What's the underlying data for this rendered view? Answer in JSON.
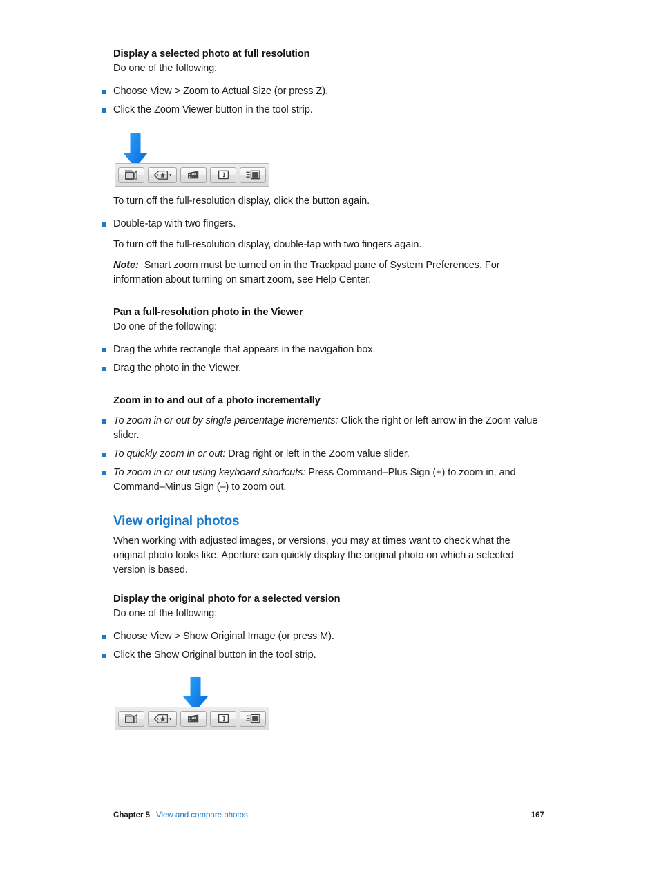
{
  "page": {
    "number": "167"
  },
  "sections": {
    "full_resolution": {
      "subhead": "Display a selected photo at full resolution",
      "intro": "Do one of the following:",
      "bullets": [
        "Choose View > Zoom to Actual Size (or press Z).",
        "Click the Zoom Viewer button in the tool strip."
      ],
      "after_figure": "To turn off the full-resolution display, click the button again.",
      "bullet_double_tap": "Double-tap with two fingers.",
      "after_double_tap": "To turn off the full-resolution display, double-tap with two fingers again.",
      "note_label": "Note:",
      "note_text": "Smart zoom must be turned on in the Trackpad pane of System Preferences. For information about turning on smart zoom, see Help Center."
    },
    "pan": {
      "subhead": "Pan a full-resolution photo in the Viewer",
      "intro": "Do one of the following:",
      "bullets": [
        "Drag the white rectangle that appears in the navigation box.",
        "Drag the photo in the Viewer."
      ]
    },
    "zoom_increments": {
      "subhead": "Zoom in to and out of a photo incrementally",
      "bullets": [
        {
          "lead_in": "To zoom in or out by single percentage increments:",
          "rest": " Click the right or left arrow in the Zoom value slider."
        },
        {
          "lead_in": "To quickly zoom in or out:",
          "rest": " Drag right or left in the Zoom value slider."
        },
        {
          "lead_in": "To zoom in or out using keyboard shortcuts:",
          "rest": " Press Command–Plus Sign (+) to zoom in, and Command–Minus Sign (–) to zoom out."
        }
      ]
    },
    "view_original": {
      "heading": "View original photos",
      "body": "When working with adjusted images, or versions, you may at times want to check what the original photo looks like. Aperture can quickly display the original photo on which a selected version is based.",
      "subhead": "Display the original photo for a selected version",
      "intro": "Do one of the following:",
      "bullets": [
        "Choose View > Show Original Image (or press M).",
        "Click the Show Original button in the tool strip."
      ]
    }
  },
  "figures": {
    "zoom_viewer_toolstrip": {
      "arrow_target": "zoom-viewer-button",
      "buttons": [
        "zoom-viewer-button",
        "rating-button",
        "show-original-button",
        "primary-only-button",
        "viewer-mode-button"
      ]
    },
    "show_original_toolstrip": {
      "arrow_target": "show-original-button",
      "buttons": [
        "zoom-viewer-button",
        "rating-button",
        "show-original-button",
        "primary-only-button",
        "viewer-mode-button"
      ]
    }
  },
  "footer": {
    "chapter": "Chapter 5",
    "title": "View and compare photos",
    "page": "167"
  },
  "colors": {
    "link": "#1f78c4",
    "heading": "#1a79c8",
    "bullet": "#1f78c4",
    "arrow_light": "#3ba7f0",
    "arrow_dark": "#0b79e8",
    "text": "#1d1d1d"
  }
}
